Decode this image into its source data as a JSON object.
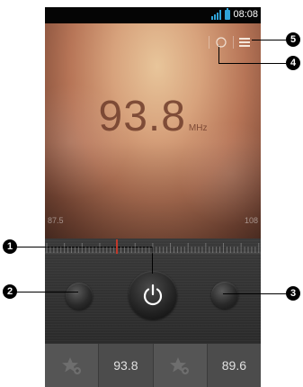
{
  "status_bar": {
    "time": "08:08"
  },
  "tuner": {
    "frequency": "93.8",
    "unit": "MHz",
    "range_min": "87.5",
    "range_max": "108"
  },
  "presets": [
    {
      "type": "favorite-add",
      "icon": "star-add-icon"
    },
    {
      "type": "frequency",
      "label": "93.8"
    },
    {
      "type": "favorite-add",
      "icon": "star-add-icon"
    },
    {
      "type": "frequency",
      "label": "89.6"
    }
  ],
  "callouts": [
    "1",
    "2",
    "3",
    "4",
    "5"
  ],
  "colors": {
    "accent": "#2fa3d8",
    "display_tint": "#b77557",
    "controls_bg": "#2b2b2b"
  }
}
